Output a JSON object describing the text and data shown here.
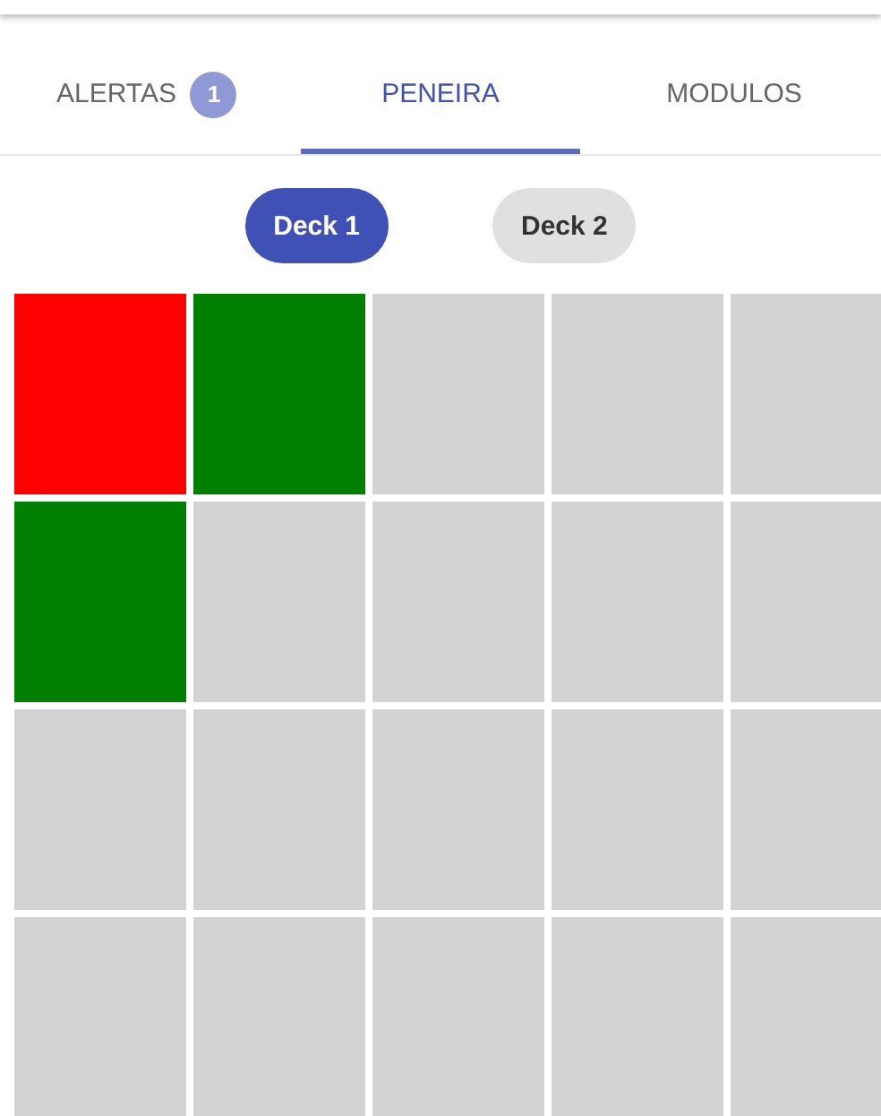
{
  "tabs": [
    {
      "label": "ALERTAS",
      "badge": "1",
      "selected": false
    },
    {
      "label": "PENEIRA",
      "selected": true
    },
    {
      "label": "MODULOS",
      "selected": false
    }
  ],
  "decks": [
    {
      "label": "Deck 1",
      "selected": true
    },
    {
      "label": "Deck 2",
      "selected": false
    }
  ],
  "grid": {
    "cells": [
      {
        "color": "#ff0000"
      },
      {
        "color": "#008000"
      },
      {
        "color": "#d3d3d3"
      },
      {
        "color": "#d3d3d3"
      },
      {
        "color": "#d3d3d3"
      },
      {
        "color": "#008000"
      },
      {
        "color": "#d3d3d3"
      },
      {
        "color": "#d3d3d3"
      },
      {
        "color": "#d3d3d3"
      },
      {
        "color": "#d3d3d3"
      },
      {
        "color": "#d3d3d3"
      },
      {
        "color": "#d3d3d3"
      },
      {
        "color": "#d3d3d3"
      },
      {
        "color": "#d3d3d3"
      },
      {
        "color": "#d3d3d3"
      },
      {
        "color": "#d3d3d3"
      },
      {
        "color": "#d3d3d3"
      },
      {
        "color": "#d3d3d3"
      },
      {
        "color": "#d3d3d3"
      },
      {
        "color": "#d3d3d3"
      }
    ]
  }
}
